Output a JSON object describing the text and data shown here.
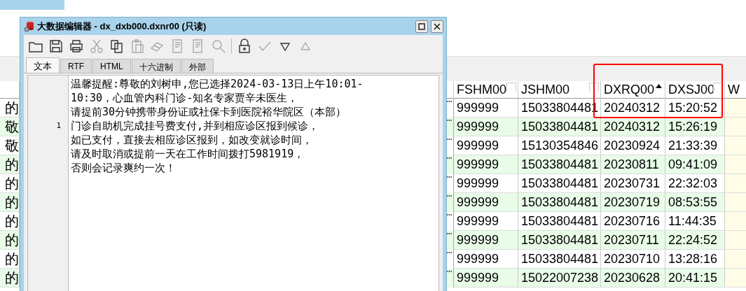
{
  "dialog": {
    "title": "大数据编辑器 - dx_dxb000.dxnr00 (只读)",
    "tabs": [
      {
        "label": "文本",
        "selected": true
      },
      {
        "label": "RTF",
        "selected": false
      },
      {
        "label": "HTML",
        "selected": false
      },
      {
        "label": "十六进制",
        "selected": false
      },
      {
        "label": "外部",
        "selected": false
      }
    ],
    "toolbar": [
      {
        "kind": "folder",
        "disabled": false
      },
      {
        "kind": "save",
        "disabled": false
      },
      {
        "kind": "print",
        "disabled": false
      },
      {
        "kind": "cut",
        "disabled": true
      },
      {
        "kind": "copy",
        "disabled": false
      },
      {
        "kind": "paste",
        "disabled": true
      },
      {
        "kind": "eraser",
        "disabled": true
      },
      {
        "kind": "doc",
        "disabled": true
      },
      {
        "kind": "doc",
        "disabled": true
      },
      {
        "kind": "search",
        "disabled": true
      },
      {
        "kind": "sep"
      },
      {
        "kind": "lock",
        "disabled": false
      },
      {
        "kind": "check",
        "disabled": true
      },
      {
        "kind": "down",
        "disabled": false
      },
      {
        "kind": "up",
        "disabled": true
      }
    ],
    "line_number": "1",
    "lines": [
      "温馨提醒:尊敬的刘树申,您已选择2024-03-13日上午10:01-",
      "10:30，心血管内科门诊-知名专家贾辛未医生，",
      "请提前30分钟携带身份证或社保卡到医院裕华院区（本部）",
      "门诊自助机完成挂号费支付,并到相应诊区报到候诊，",
      "如已支付，直接去相应诊区报到，如改变就诊时间，",
      "请及时取消或提前一天在工作时间拨打5981919，",
      "否则会记录爽约一次！"
    ]
  },
  "table": {
    "columns": [
      {
        "label": "FSHM00",
        "sorted": false
      },
      {
        "label": "JSHM00",
        "sorted": false
      },
      {
        "label": "DXRQ00",
        "sorted": true
      },
      {
        "label": "DXSJ00",
        "sorted": false
      },
      {
        "label": "W"
      }
    ],
    "rows": [
      {
        "column_1": "的",
        "cells": [
          "999999",
          "15033804481",
          "20240312",
          "15:20:52"
        ]
      },
      {
        "column_1": "敬",
        "cells": [
          "999999",
          "15033804481",
          "20240312",
          "15:26:19"
        ]
      },
      {
        "column_1": "敬",
        "cells": [
          "999999",
          "15130354846",
          "20230924",
          "21:33:39"
        ]
      },
      {
        "column_1": "的",
        "cells": [
          "999999",
          "15033804481",
          "20230811",
          "09:41:09"
        ]
      },
      {
        "column_1": "的",
        "cells": [
          "999999",
          "15033804481",
          "20230731",
          "22:32:03"
        ]
      },
      {
        "column_1": "的",
        "cells": [
          "999999",
          "15033804481",
          "20230719",
          "08:53:55"
        ]
      },
      {
        "column_1": "的",
        "cells": [
          "999999",
          "15033804481",
          "20230716",
          "11:44:35"
        ]
      },
      {
        "column_1": "的",
        "cells": [
          "999999",
          "15033804481",
          "20230711",
          "22:24:52"
        ]
      },
      {
        "column_1": "的",
        "cells": [
          "999999",
          "15033804481",
          "20230710",
          "13:28:16"
        ]
      },
      {
        "column_1": "的",
        "cells": [
          "999999",
          "15022007238",
          "20230628",
          "20:41:15"
        ]
      }
    ]
  }
}
